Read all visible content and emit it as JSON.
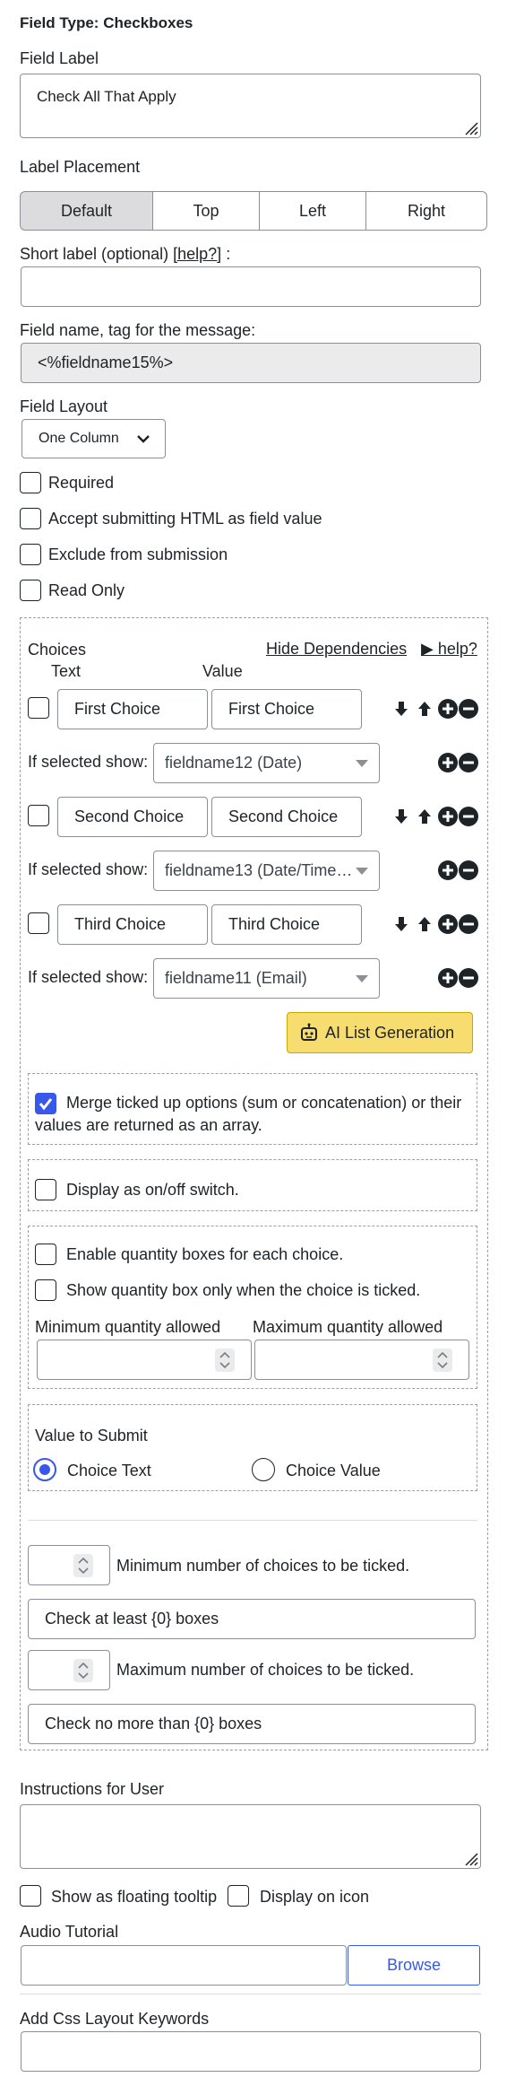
{
  "header": {
    "title": "Field Type: Checkboxes"
  },
  "field_label": {
    "label": "Field Label",
    "value": "Check All That Apply"
  },
  "label_placement": {
    "label": "Label Placement",
    "options": [
      "Default",
      "Top",
      "Left",
      "Right"
    ],
    "selected": "Default"
  },
  "short_label": {
    "label": "Short label (optional)",
    "help": "[help?]",
    "suffix": ":",
    "value": ""
  },
  "field_name": {
    "label": "Field name, tag for the message:",
    "value": "<%fieldname15%>"
  },
  "field_layout": {
    "label": "Field Layout",
    "value": "One Column"
  },
  "options": {
    "required": {
      "label": "Required",
      "checked": false
    },
    "accept_html": {
      "label": "Accept submitting HTML as field value",
      "checked": false
    },
    "exclude": {
      "label": "Exclude from submission",
      "checked": false
    },
    "read_only": {
      "label": "Read Only",
      "checked": false
    }
  },
  "choices": {
    "title": "Choices",
    "hide_dependencies": "Hide Dependencies",
    "help": "▶ help?",
    "col_text": "Text",
    "col_value": "Value",
    "if_selected_label": "If selected show:",
    "items": [
      {
        "text": "First Choice",
        "value": "First Choice",
        "dependency": "fieldname12 (Date)"
      },
      {
        "text": "Second Choice",
        "value": "Second Choice",
        "dependency": "fieldname13 (Date/Time…"
      },
      {
        "text": "Third Choice",
        "value": "Third Choice",
        "dependency": "fieldname11 (Email)"
      }
    ],
    "ai_button": "AI List Generation"
  },
  "merge": {
    "label": "Merge ticked up options (sum or concatenation) or their values are returned as an array.",
    "checked": true
  },
  "onoff": {
    "label": "Display as on/off switch.",
    "checked": false
  },
  "quantity": {
    "enable_label": "Enable quantity boxes for each choice.",
    "only_when_ticked_label": "Show quantity box only when the choice is ticked.",
    "min_label": "Minimum quantity allowed",
    "max_label": "Maximum quantity allowed",
    "min_value": "",
    "max_value": ""
  },
  "value_to_submit": {
    "label": "Value to Submit",
    "options": [
      "Choice Text",
      "Choice Value"
    ],
    "selected": "Choice Text"
  },
  "min_choices": {
    "label": "Minimum number of choices to be ticked.",
    "value": "",
    "message": "Check at least {0} boxes"
  },
  "max_choices": {
    "label": "Maximum number of choices to be ticked.",
    "value": "",
    "message": "Check no more than {0} boxes"
  },
  "instructions": {
    "label": "Instructions for User",
    "value": ""
  },
  "tooltip": {
    "floating_label": "Show as floating tooltip",
    "icon_label": "Display on icon"
  },
  "audio": {
    "label": "Audio Tutorial",
    "value": "",
    "browse": "Browse"
  },
  "css_keywords": {
    "label": "Add Css Layout Keywords",
    "value": ""
  },
  "colors": {
    "accent": "#3858e9",
    "ai_button_bg": "#f7dc6f",
    "segment_active": "#dcdcde"
  }
}
